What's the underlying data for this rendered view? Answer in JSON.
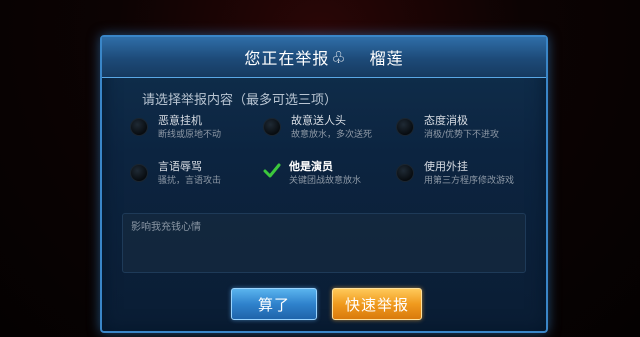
{
  "dialog": {
    "title": "您正在举报",
    "title_icon": "club-icon",
    "reported_player": "榴莲",
    "prompt": "请选择举报内容（最多可选三项）",
    "options": [
      {
        "label": "恶意挂机",
        "desc": "断线或原地不动",
        "checked": false
      },
      {
        "label": "故意送人头",
        "desc": "故意放水，多次送死",
        "checked": false
      },
      {
        "label": "态度消极",
        "desc": "消极/优势下不进攻",
        "checked": false
      },
      {
        "label": "言语辱骂",
        "desc": "骚扰，言语攻击",
        "checked": false
      },
      {
        "label": "他是演员",
        "desc": "关键团战故意放水",
        "checked": true
      },
      {
        "label": "使用外挂",
        "desc": "用第三方程序修改游戏",
        "checked": false
      }
    ],
    "comment_placeholder": "影响我充钱心情",
    "cancel_label": "算了",
    "submit_label": "快速举报"
  },
  "colors": {
    "dialog_border": "#3a86c8",
    "cancel_button": "#2f82cc",
    "submit_button": "#f09a1e",
    "checkmark": "#3cc83c"
  }
}
